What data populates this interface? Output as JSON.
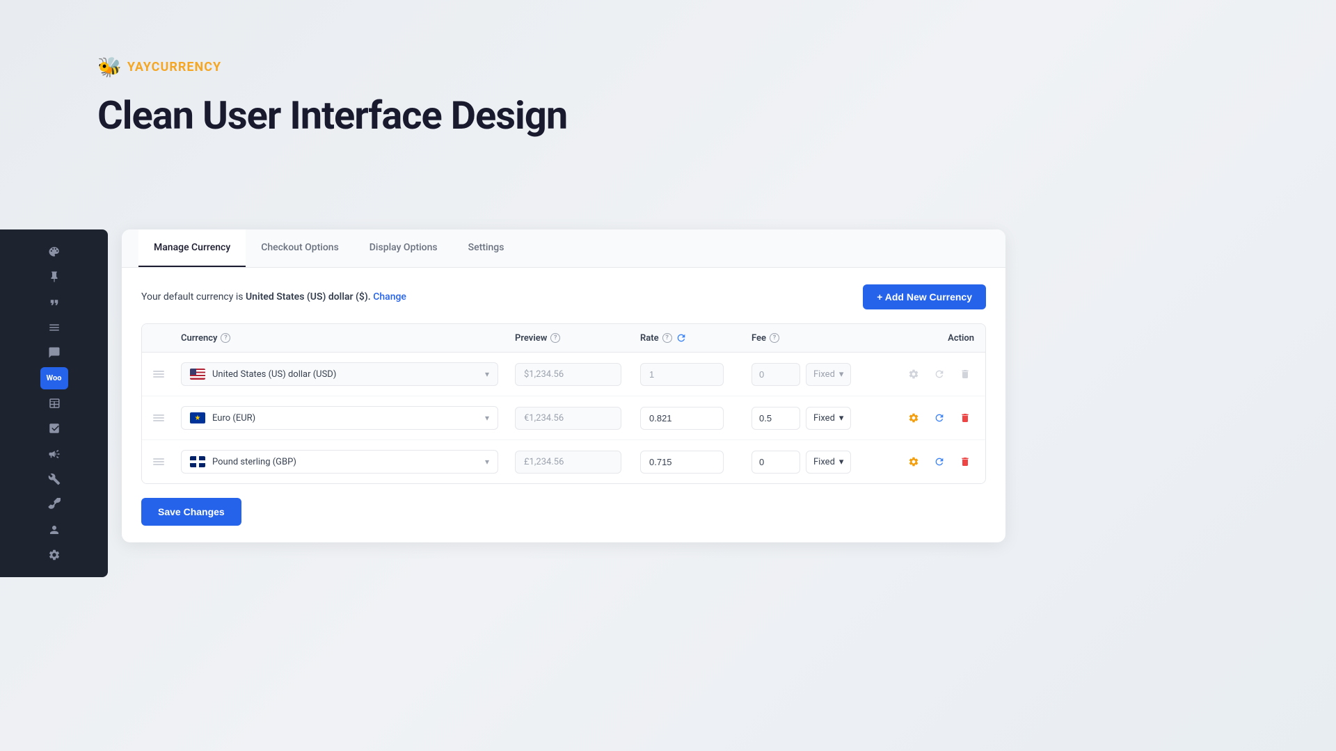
{
  "brand": {
    "name": "YAYCURRENCY",
    "icon": "🐝"
  },
  "page": {
    "title": "Clean User Interface Design"
  },
  "tabs": [
    {
      "id": "manage-currency",
      "label": "Manage Currency",
      "active": true
    },
    {
      "id": "checkout-options",
      "label": "Checkout Options",
      "active": false
    },
    {
      "id": "display-options",
      "label": "Display Options",
      "active": false
    },
    {
      "id": "settings",
      "label": "Settings",
      "active": false
    }
  ],
  "default_currency": {
    "text_prefix": "Your default currency is ",
    "currency_name": "United States (US) dollar ($).",
    "change_label": "Change"
  },
  "add_currency_btn": "+ Add New Currency",
  "table": {
    "headers": {
      "currency": "Currency",
      "preview": "Preview",
      "rate": "Rate",
      "fee": "Fee",
      "action": "Action"
    },
    "rows": [
      {
        "id": "usd",
        "flag_type": "us",
        "currency_name": "United States (US) dollar (USD)",
        "preview": "$1,234.56",
        "rate": "1",
        "fee": "0",
        "fee_type": "Fixed",
        "disabled": true
      },
      {
        "id": "eur",
        "flag_type": "eu",
        "currency_name": "Euro (EUR)",
        "preview": "€1,234.56",
        "rate": "0.821",
        "fee": "0.5",
        "fee_type": "Fixed",
        "disabled": false
      },
      {
        "id": "gbp",
        "flag_type": "gb",
        "currency_name": "Pound sterling (GBP)",
        "preview": "£1,234.56",
        "rate": "0.715",
        "fee": "0",
        "fee_type": "Fixed",
        "disabled": false
      }
    ]
  },
  "save_btn": "Save Changes",
  "sidebar": {
    "items": [
      {
        "icon": "palette",
        "label": "Design"
      },
      {
        "icon": "pin",
        "label": "Pin"
      },
      {
        "icon": "quote",
        "label": "Quote"
      },
      {
        "icon": "pages",
        "label": "Pages"
      },
      {
        "icon": "comments",
        "label": "Comments"
      },
      {
        "icon": "woo",
        "label": "Woo"
      },
      {
        "icon": "table",
        "label": "Table"
      },
      {
        "icon": "analytics",
        "label": "Analytics"
      },
      {
        "icon": "megaphone",
        "label": "Megaphone"
      },
      {
        "icon": "tools",
        "label": "Tools"
      },
      {
        "icon": "wrench",
        "label": "Wrench"
      },
      {
        "icon": "user",
        "label": "User"
      },
      {
        "icon": "settings",
        "label": "Settings"
      }
    ]
  }
}
